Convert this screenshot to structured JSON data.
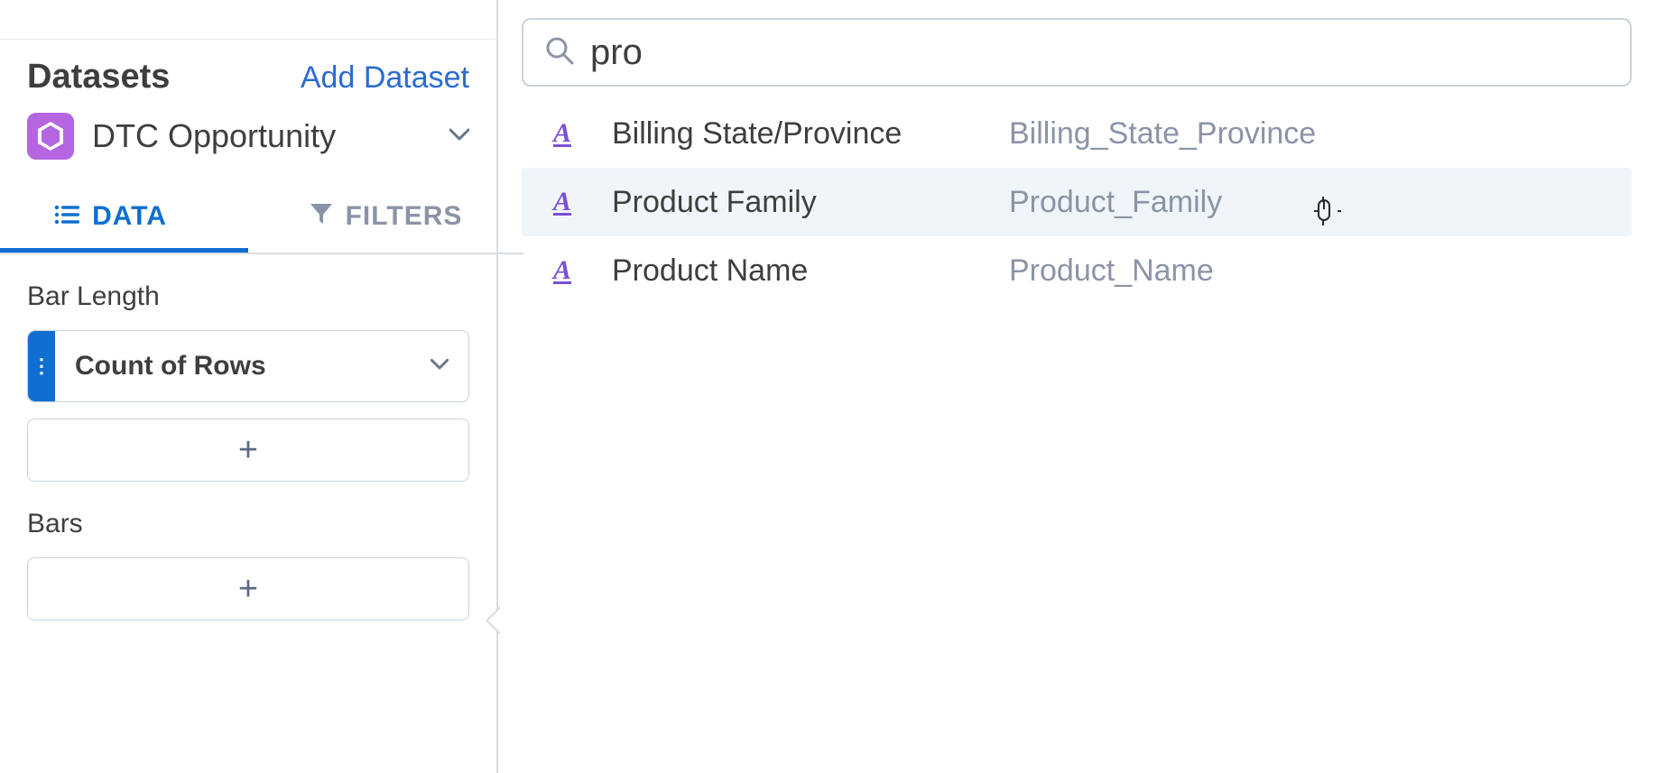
{
  "sidebar": {
    "datasets_title": "Datasets",
    "add_dataset_label": "Add Dataset",
    "selected_dataset": "DTC Opportunity",
    "tabs": {
      "data": "DATA",
      "filters": "FILTERS"
    },
    "sections": {
      "bar_length": {
        "label": "Bar Length",
        "field": "Count of Rows"
      },
      "bars": {
        "label": "Bars"
      }
    }
  },
  "search": {
    "value": "pro"
  },
  "results": [
    {
      "label": "Billing State/Province",
      "api": "Billing_State_Province",
      "hover": false
    },
    {
      "label": "Product Family",
      "api": "Product_Family",
      "hover": true
    },
    {
      "label": "Product Name",
      "api": "Product_Name",
      "hover": false
    }
  ],
  "icons": {
    "plus": "+",
    "handle": "⋮"
  }
}
